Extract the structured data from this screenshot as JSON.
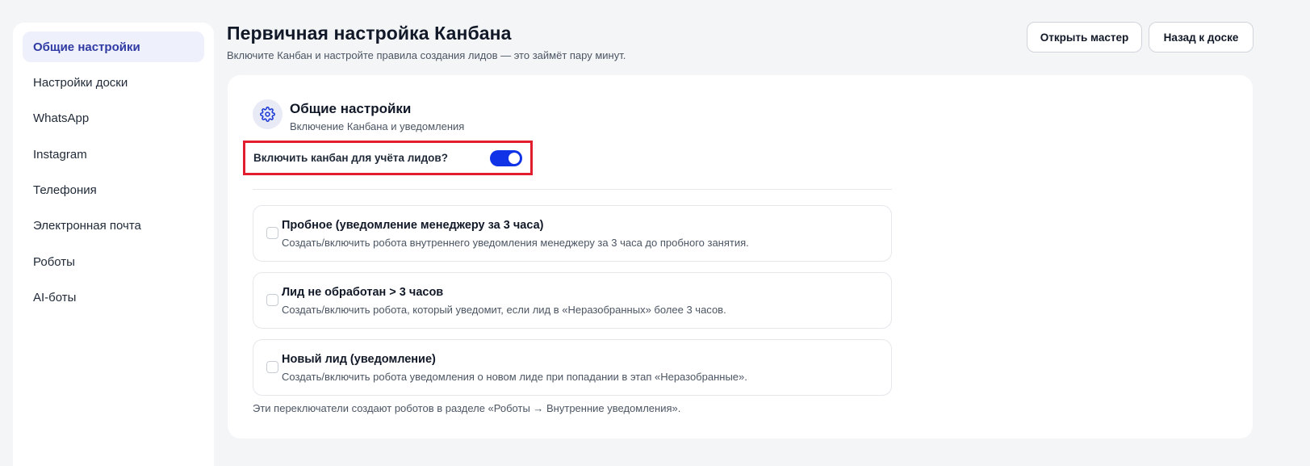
{
  "sidebar": {
    "items": [
      {
        "label": "Общие настройки"
      },
      {
        "label": "Настройки доски"
      },
      {
        "label": "WhatsApp"
      },
      {
        "label": "Instagram"
      },
      {
        "label": "Телефония"
      },
      {
        "label": "Электронная почта"
      },
      {
        "label": "Роботы"
      },
      {
        "label": "AI-боты"
      }
    ],
    "active_item": "Общие настройки"
  },
  "header": {
    "title": "Первичная настройка Канбана",
    "subtitle": "Включите Канбан и настройте правила создания лидов — это займёт пару минут.",
    "open_wizard_label": "Открыть мастер",
    "back_label": "Назад к доске"
  },
  "section": {
    "icon": "gear-icon",
    "title": "Общие настройки",
    "subtitle": "Включение Канбана и уведомления",
    "toggle": {
      "label": "Включить канбан для учёта лидов?",
      "checked": true
    }
  },
  "robots": [
    {
      "title": "Пробное (уведомление менеджеру за 3 часа)",
      "description": "Создать/включить робота внутреннего уведомления менеджеру за 3 часа до пробного занятия.",
      "checked": false
    },
    {
      "title": "Лид не обработан > 3 часов",
      "description": "Создать/включить робота, который уведомит, если лид в «Неразобранных» более 3 часов.",
      "checked": false
    },
    {
      "title": "Новый лид (уведомление)",
      "description": "Создать/включить робота уведомления о новом лиде при попадании в этап «Неразобранные».",
      "checked": false
    }
  ],
  "footer_note": "Эти переключатели создают роботов в разделе «Роботы → Внутренние уведомления».",
  "colors": {
    "accent": "#1133e8",
    "active_nav_bg": "#eef0fb",
    "active_nav_text": "#2f3aa3",
    "highlight_border": "#e11d2e"
  }
}
